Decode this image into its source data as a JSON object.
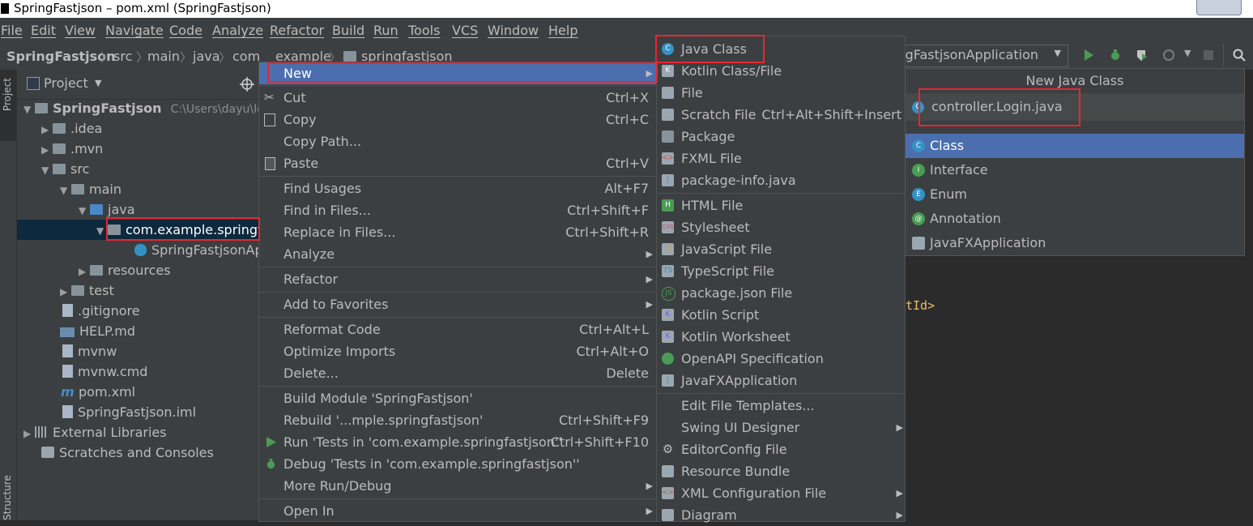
{
  "window": {
    "title": "SpringFastjson – pom.xml (SpringFastjson)"
  },
  "menubar": [
    "File",
    "Edit",
    "View",
    "Navigate",
    "Code",
    "Analyze",
    "Refactor",
    "Build",
    "Run",
    "Tools",
    "VCS",
    "Window",
    "Help"
  ],
  "breadcrumb": [
    "SpringFastjson",
    "src",
    "main",
    "java",
    "com",
    "example",
    "springfastjson"
  ],
  "run_config": "SpringFastjsonApplication",
  "left_stripe": {
    "project_tab": "Project",
    "structure_tab": "Structure"
  },
  "project_panel": {
    "title": "Project",
    "root_name": "SpringFastjson",
    "root_path": "C:\\Users\\dayu\\Ide",
    "items": [
      {
        "label": ".idea"
      },
      {
        "label": ".mvn"
      },
      {
        "label": "src"
      },
      {
        "label": "main"
      },
      {
        "label": "java"
      },
      {
        "label": "com.example.springf"
      },
      {
        "label": "SpringFastjsonAp"
      },
      {
        "label": "resources"
      },
      {
        "label": "test"
      },
      {
        "label": ".gitignore"
      },
      {
        "label": "HELP.md"
      },
      {
        "label": "mvnw"
      },
      {
        "label": "mvnw.cmd"
      },
      {
        "label": "pom.xml"
      },
      {
        "label": "SpringFastjson.iml"
      },
      {
        "label": "External Libraries"
      },
      {
        "label": "Scratches and Consoles"
      }
    ]
  },
  "context_menu": {
    "items": [
      {
        "label": "New",
        "shortcut": "",
        "submenu": true
      },
      {
        "label": "Cut",
        "shortcut": "Ctrl+X"
      },
      {
        "label": "Copy",
        "shortcut": "Ctrl+C"
      },
      {
        "label": "Copy Path...",
        "shortcut": ""
      },
      {
        "label": "Paste",
        "shortcut": "Ctrl+V"
      },
      {
        "label": "Find Usages",
        "shortcut": "Alt+F7"
      },
      {
        "label": "Find in Files...",
        "shortcut": "Ctrl+Shift+F"
      },
      {
        "label": "Replace in Files...",
        "shortcut": "Ctrl+Shift+R"
      },
      {
        "label": "Analyze",
        "shortcut": "",
        "submenu": true
      },
      {
        "label": "Refactor",
        "shortcut": "",
        "submenu": true
      },
      {
        "label": "Add to Favorites",
        "shortcut": "",
        "submenu": true
      },
      {
        "label": "Reformat Code",
        "shortcut": "Ctrl+Alt+L"
      },
      {
        "label": "Optimize Imports",
        "shortcut": "Ctrl+Alt+O"
      },
      {
        "label": "Delete...",
        "shortcut": "Delete"
      },
      {
        "label": "Build Module 'SpringFastjson'",
        "shortcut": ""
      },
      {
        "label": "Rebuild '...mple.springfastjson'",
        "shortcut": "Ctrl+Shift+F9"
      },
      {
        "label": "Run 'Tests in 'com.example.springfastjson''",
        "shortcut": "Ctrl+Shift+F10"
      },
      {
        "label": "Debug 'Tests in 'com.example.springfastjson''",
        "shortcut": ""
      },
      {
        "label": "More Run/Debug",
        "shortcut": "",
        "submenu": true
      },
      {
        "label": "Open In",
        "shortcut": "",
        "submenu": true
      }
    ]
  },
  "new_submenu": {
    "items": [
      {
        "label": "Java Class",
        "shortcut": ""
      },
      {
        "label": "Kotlin Class/File",
        "shortcut": ""
      },
      {
        "label": "File",
        "shortcut": ""
      },
      {
        "label": "Scratch File",
        "shortcut": "Ctrl+Alt+Shift+Insert"
      },
      {
        "label": "Package",
        "shortcut": ""
      },
      {
        "label": "FXML File",
        "shortcut": ""
      },
      {
        "label": "package-info.java",
        "shortcut": ""
      },
      {
        "label": "HTML File",
        "shortcut": ""
      },
      {
        "label": "Stylesheet",
        "shortcut": ""
      },
      {
        "label": "JavaScript File",
        "shortcut": ""
      },
      {
        "label": "TypeScript File",
        "shortcut": ""
      },
      {
        "label": "package.json File",
        "shortcut": ""
      },
      {
        "label": "Kotlin Script",
        "shortcut": ""
      },
      {
        "label": "Kotlin Worksheet",
        "shortcut": ""
      },
      {
        "label": "OpenAPI Specification",
        "shortcut": ""
      },
      {
        "label": "JavaFXApplication",
        "shortcut": ""
      },
      {
        "label": "Edit File Templates...",
        "shortcut": ""
      },
      {
        "label": "Swing UI Designer",
        "shortcut": "",
        "submenu": true
      },
      {
        "label": "EditorConfig File",
        "shortcut": ""
      },
      {
        "label": "Resource Bundle",
        "shortcut": ""
      },
      {
        "label": "XML Configuration File",
        "shortcut": "",
        "submenu": true
      },
      {
        "label": "Diagram",
        "shortcut": "",
        "submenu": true
      }
    ]
  },
  "new_java_class": {
    "title": "New Java Class",
    "input_value": "controller.Login.java",
    "options": [
      {
        "label": "Class",
        "icon_letter": "C"
      },
      {
        "label": "Interface",
        "icon_letter": "I"
      },
      {
        "label": "Enum",
        "icon_letter": "E"
      },
      {
        "label": "Annotation",
        "icon_letter": "@"
      },
      {
        "label": "JavaFXApplication",
        "icon_letter": ""
      }
    ]
  },
  "editor_fragment": "tId>",
  "colors": {
    "selection": "#4b6eaf",
    "highlight_box": "#e8262f",
    "panel_bg": "#3c3f41",
    "editor_bg": "#2b2b2b"
  }
}
